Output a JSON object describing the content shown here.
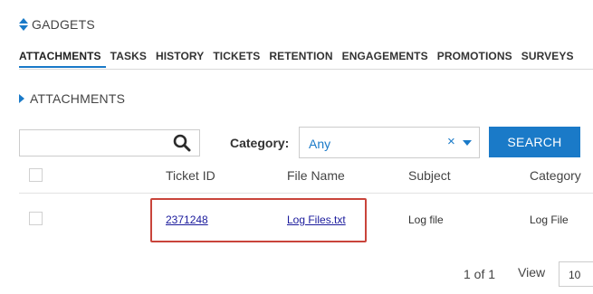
{
  "gadgets": {
    "title": "GADGETS"
  },
  "tabs": [
    {
      "label": "ATTACHMENTS"
    },
    {
      "label": "TASKS"
    },
    {
      "label": "HISTORY"
    },
    {
      "label": "TICKETS"
    },
    {
      "label": "RETENTION"
    },
    {
      "label": "ENGAGEMENTS"
    },
    {
      "label": "PROMOTIONS"
    },
    {
      "label": "SURVEYS"
    }
  ],
  "section": {
    "title": "ATTACHMENTS"
  },
  "search": {
    "value": "",
    "button_label": "SEARCH"
  },
  "category": {
    "label": "Category:",
    "value": "Any",
    "clear_glyph": "×"
  },
  "table": {
    "columns": [
      "Ticket ID",
      "File Name",
      "Subject",
      "Category"
    ],
    "rows": [
      {
        "ticket_id": "2371248",
        "file_name": "Log Files.txt",
        "subject": "Log file",
        "category": "Log File"
      }
    ]
  },
  "pager": {
    "summary": "1 of 1",
    "view_label": "View",
    "page_size": "10"
  },
  "colors": {
    "accent": "#1a7ac8",
    "highlight": "#c9443b",
    "link": "#1a1a9c"
  }
}
